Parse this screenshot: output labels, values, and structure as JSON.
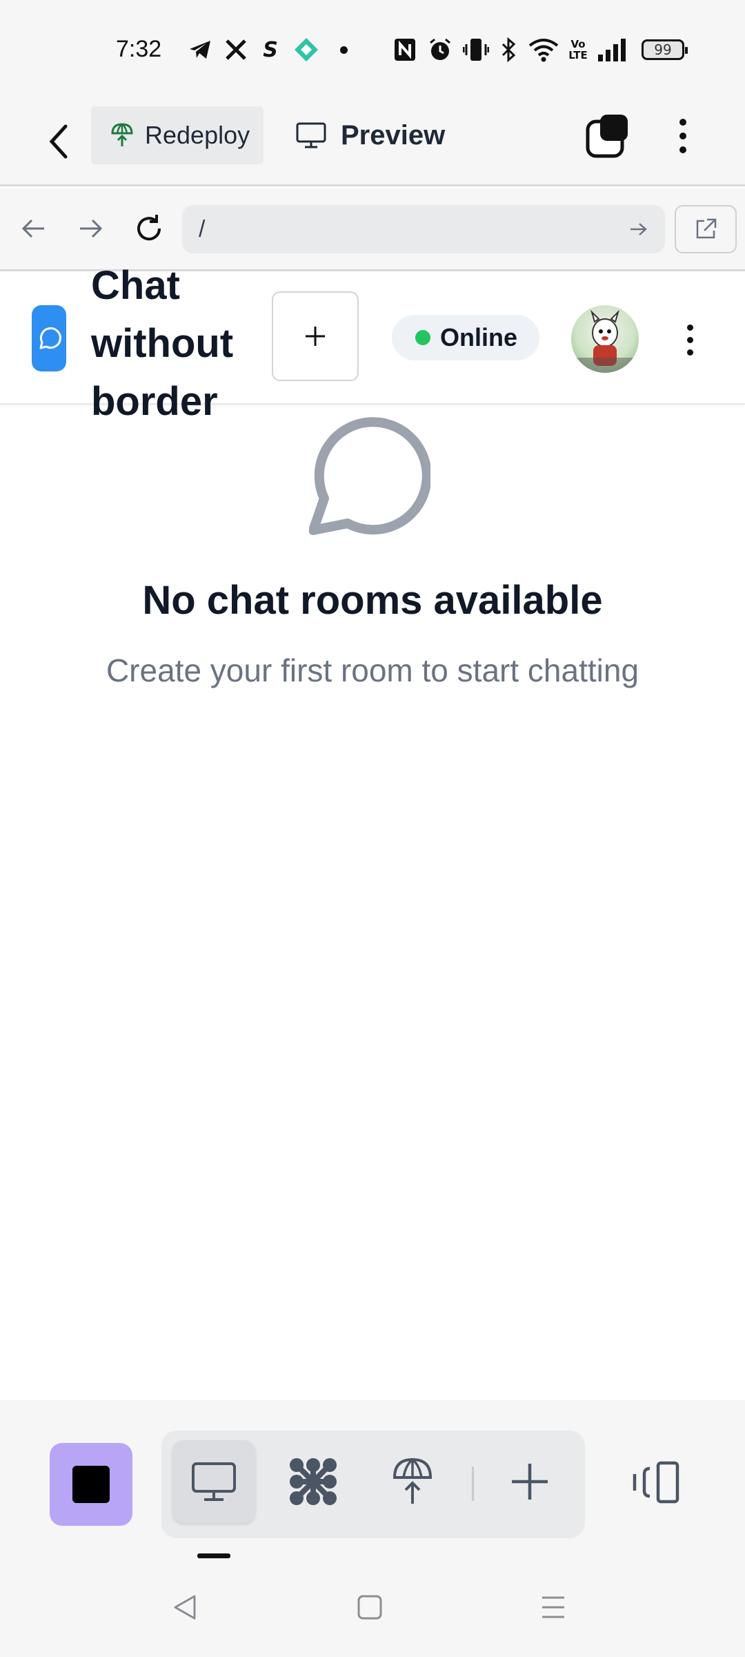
{
  "status_bar": {
    "time": "7:32",
    "icons": [
      "telegram-icon",
      "x-icon",
      "s-app-icon",
      "diamond-app-icon",
      "dot-icon",
      "nfc-icon",
      "alarm-icon",
      "vibrate-icon",
      "bluetooth-icon",
      "wifi-icon",
      "volte-icon",
      "signal-icon"
    ],
    "volte_label": "Vo\nLTE",
    "battery": "99"
  },
  "app_bar": {
    "redeploy_label": "Redeploy",
    "preview_label": "Preview"
  },
  "browser": {
    "url": "/"
  },
  "app_header": {
    "title": "Chat without border",
    "status": "Online",
    "status_color": "#22c55e",
    "logo_color": "#2f8ef2"
  },
  "empty_state": {
    "title": "No chat rooms available",
    "subtitle": "Create your first room to start chatting"
  },
  "bottom_toolbar": {
    "stop_color": "#b9a5f5",
    "tools": [
      "desktop-icon",
      "network-icon",
      "deploy-icon",
      "add-icon"
    ]
  }
}
